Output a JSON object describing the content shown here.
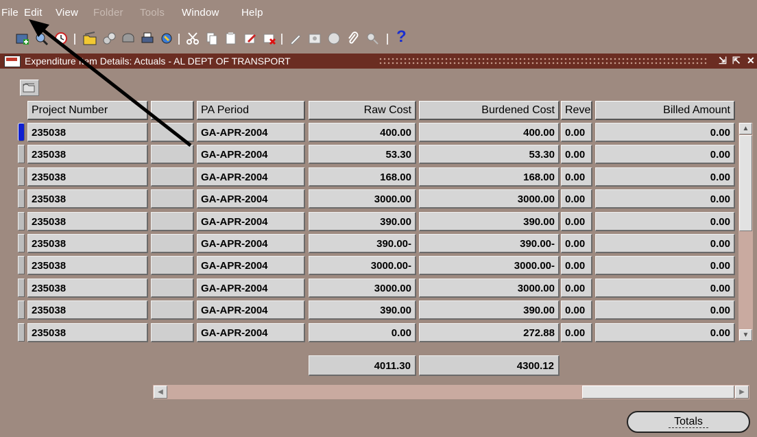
{
  "menu": [
    {
      "label": "File",
      "enabled": true
    },
    {
      "label": "Edit",
      "enabled": true
    },
    {
      "label": "View",
      "enabled": true
    },
    {
      "label": "Folder",
      "enabled": false
    },
    {
      "label": "Tools",
      "enabled": false
    },
    {
      "label": "Window",
      "enabled": true
    },
    {
      "label": "Help",
      "enabled": true
    }
  ],
  "toolbar": {
    "icons": [
      "new-icon",
      "find-icon",
      "clock-icon",
      "save-icon",
      "navigate-icon",
      "zoom-icon",
      "print-icon",
      "export-icon",
      "cut-icon",
      "copy-icon",
      "paste-icon",
      "edit-icon",
      "delete-icon",
      "pen-icon",
      "folder-tools-icon",
      "globe-icon",
      "attach-icon",
      "flexfield-icon"
    ],
    "help_glyph": "?"
  },
  "window": {
    "title": "Expenditure Item Details: Actuals - AL DEPT OF TRANSPORT",
    "controls": [
      "minimize",
      "maximize",
      "close"
    ]
  },
  "table": {
    "columns": [
      "Project Number",
      "",
      "PA Period",
      "Raw Cost",
      "Burdened Cost",
      "Reve",
      "Billed Amount"
    ],
    "rows": [
      [
        "235038",
        "",
        "GA-APR-2004",
        "400.00",
        "400.00",
        "0.00",
        "0.00"
      ],
      [
        "235038",
        "",
        "GA-APR-2004",
        "53.30",
        "53.30",
        "0.00",
        "0.00"
      ],
      [
        "235038",
        "",
        "GA-APR-2004",
        "168.00",
        "168.00",
        "0.00",
        "0.00"
      ],
      [
        "235038",
        "",
        "GA-APR-2004",
        "3000.00",
        "3000.00",
        "0.00",
        "0.00"
      ],
      [
        "235038",
        "",
        "GA-APR-2004",
        "390.00",
        "390.00",
        "0.00",
        "0.00"
      ],
      [
        "235038",
        "",
        "GA-APR-2004",
        "390.00-",
        "390.00-",
        "0.00",
        "0.00"
      ],
      [
        "235038",
        "",
        "GA-APR-2004",
        "3000.00-",
        "3000.00-",
        "0.00",
        "0.00"
      ],
      [
        "235038",
        "",
        "GA-APR-2004",
        "3000.00",
        "3000.00",
        "0.00",
        "0.00"
      ],
      [
        "235038",
        "",
        "GA-APR-2004",
        "390.00",
        "390.00",
        "0.00",
        "0.00"
      ],
      [
        "235038",
        "",
        "GA-APR-2004",
        "0.00",
        "272.88",
        "0.00",
        "0.00"
      ]
    ],
    "active_row": 0,
    "totals": {
      "raw_cost": "4011.30",
      "burdened_cost": "4300.12"
    }
  },
  "buttons": {
    "totals": "Totals"
  },
  "colors": {
    "background": "#9e8a80",
    "title_bar": "#6b2d22",
    "scrollbar_track": "#c9aaa0",
    "active_row_indicator": "#1020d0"
  }
}
